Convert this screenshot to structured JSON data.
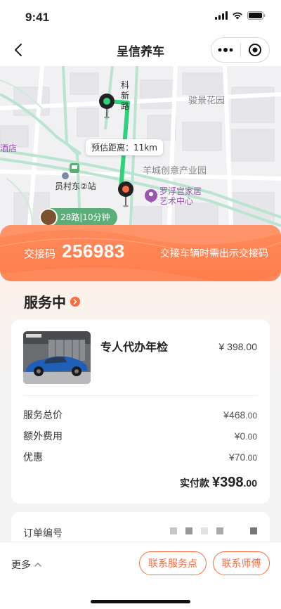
{
  "status_bar": {
    "time": "9:41"
  },
  "nav": {
    "title": "呈信养车"
  },
  "map": {
    "eta_label": "预估距离：11km",
    "road_label": "科新路",
    "road_chars": [
      "科",
      "新",
      "路"
    ],
    "labels": {
      "junjing": "骏景花园",
      "yangcheng": "羊城创意产业园",
      "station": "员村东②站",
      "hotel": "酒店",
      "museum_line1": "罗浮宫家居",
      "museum_line2": "艺术中心"
    },
    "bus": {
      "route": "28路",
      "time": "10分钟"
    },
    "colors": {
      "route": "#2fd17a",
      "start": "#2fd17a",
      "end": "#ff6a3d"
    }
  },
  "handover": {
    "label": "交接码",
    "code": "256983",
    "hint": "交接车辆时需出示交接码"
  },
  "service": {
    "status_title": "服务中",
    "item_name": "专人代办年检",
    "item_price": "¥ 398.00",
    "rows": [
      {
        "label": "服务总价",
        "value_int": "¥468",
        "value_dec": ".00"
      },
      {
        "label": "额外费用",
        "value_int": "¥0",
        "value_dec": ".00"
      },
      {
        "label": "优惠",
        "value_int": "¥70",
        "value_dec": ".00"
      }
    ],
    "paid_label": "实付款",
    "paid_int": "¥398",
    "paid_dec": ".00"
  },
  "order": {
    "number_label": "订单编号"
  },
  "bottom": {
    "more_label": "更多",
    "contact_station": "联系服务点",
    "contact_master": "联系师傅"
  },
  "theme": {
    "accent": "#ff6a3d",
    "route_green": "#2fd17a"
  }
}
